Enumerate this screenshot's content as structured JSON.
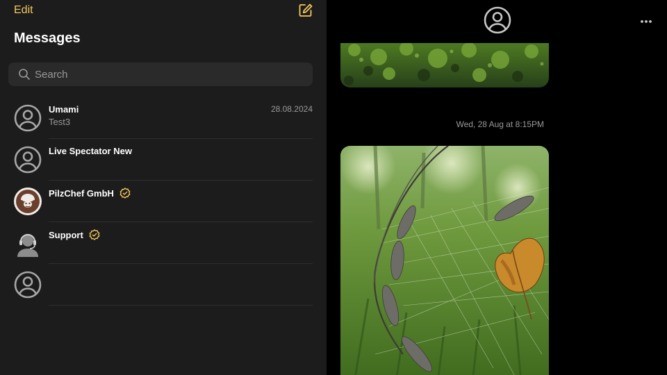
{
  "sidebar": {
    "edit_label": "Edit",
    "title": "Messages",
    "search": {
      "placeholder": "Search",
      "value": ""
    },
    "conversations": [
      {
        "name": "Umami",
        "preview": "Test3",
        "date": "28.08.2024",
        "avatar": "person-icon",
        "verified": false
      },
      {
        "name": "Live Spectator New",
        "preview": "",
        "date": "",
        "avatar": "person-icon",
        "verified": false
      },
      {
        "name": "PilzChef GmbH",
        "preview": "",
        "date": "",
        "avatar": "mushroom-chef-logo",
        "verified": true
      },
      {
        "name": "Support",
        "preview": "",
        "date": "",
        "avatar": "headset-agent-icon",
        "verified": true
      },
      {
        "name": "",
        "preview": "",
        "date": "",
        "avatar": "person-icon",
        "verified": false
      }
    ]
  },
  "chat": {
    "timestamp": "Wed, 28 Aug at  8:15PM",
    "images": [
      "moss-photo",
      "grass-seedheads-photo"
    ]
  },
  "colors": {
    "accent": "#f4c95d",
    "sidebar_bg": "#1c1c1c",
    "chat_bg": "#000000",
    "muted_text": "#9a9a9a"
  }
}
